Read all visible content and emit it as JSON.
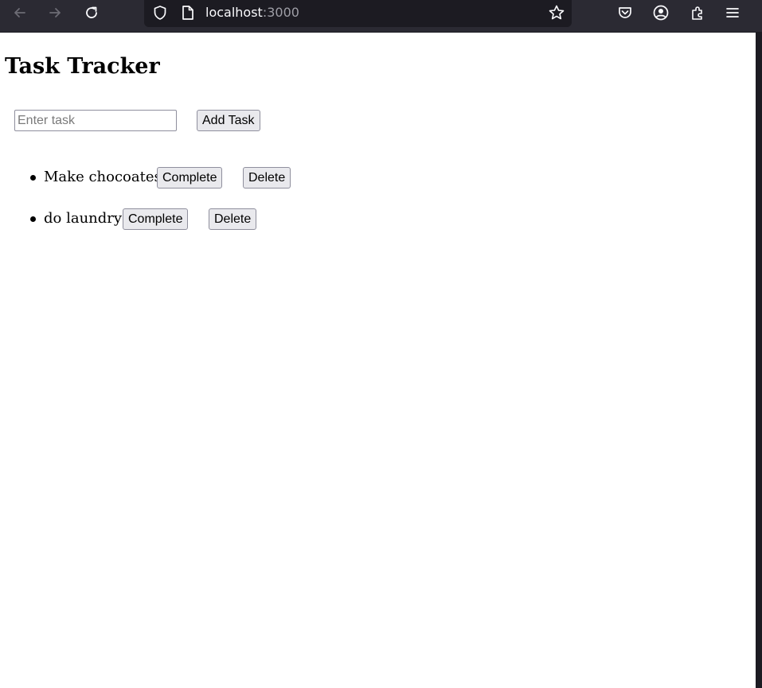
{
  "browser": {
    "back_icon": "arrow-left-icon",
    "forward_icon": "arrow-right-icon",
    "reload_icon": "reload-icon",
    "url_host": "localhost",
    "url_port": ":3000",
    "bookmark_icon": "star-icon",
    "pocket_icon": "pocket-icon",
    "account_icon": "account-icon",
    "extensions_icon": "puzzle-icon",
    "menu_icon": "hamburger-menu-icon",
    "colors": {
      "toolbar": "#2b2a33",
      "urlbar": "#1c1b22"
    }
  },
  "page": {
    "title": "Task Tracker",
    "input": {
      "placeholder": "Enter task",
      "value": ""
    },
    "add_button_label": "Add Task",
    "tasks": [
      {
        "text": "Make chocoates",
        "complete_label": "Complete",
        "delete_label": "Delete"
      },
      {
        "text": "do laundry",
        "complete_label": "Complete",
        "delete_label": "Delete"
      }
    ]
  }
}
